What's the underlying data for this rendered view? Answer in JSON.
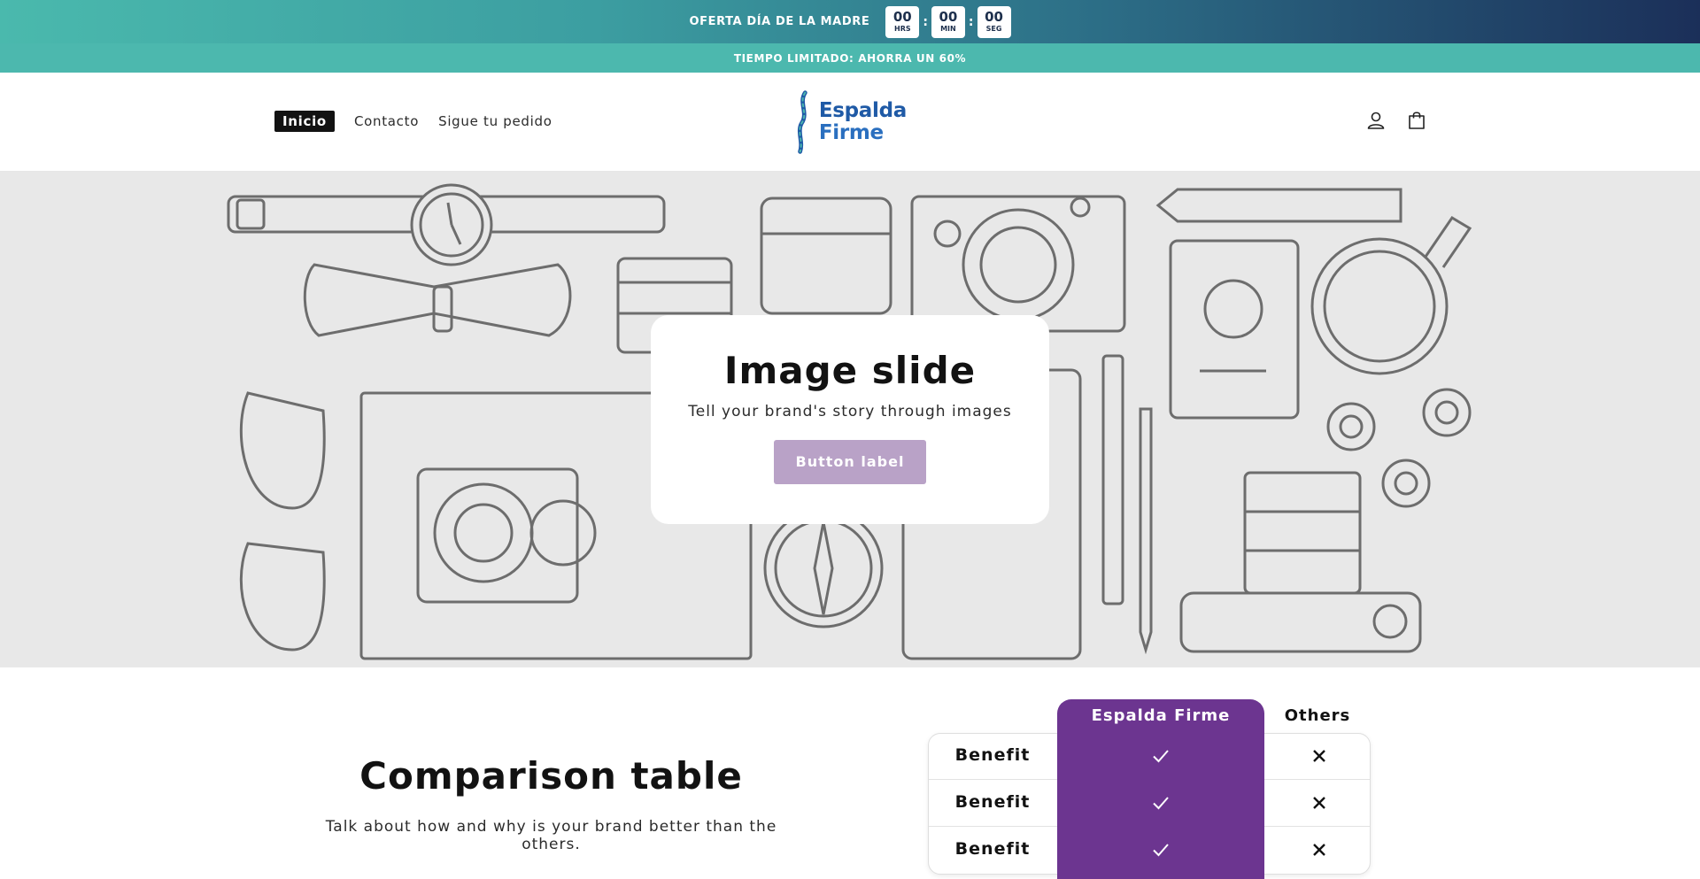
{
  "countdown": {
    "offer_text": "OFERTA DÍA DE LA MADRE",
    "hours": "00",
    "hours_label": "HRS",
    "minutes": "00",
    "minutes_label": "MIN",
    "seconds": "00",
    "seconds_label": "SEG",
    "separator": ":"
  },
  "announcement": {
    "text": "TIEMPO LIMITADO: AHORRA UN 60%"
  },
  "nav": {
    "items": [
      {
        "label": "Inicio",
        "active": true
      },
      {
        "label": "Contacto"
      },
      {
        "label": "Sigue tu pedido"
      }
    ]
  },
  "logo": {
    "line1": "Espalda",
    "line2": "Firme"
  },
  "header_icons": [
    "account-icon",
    "cart-icon"
  ],
  "slide": {
    "title": "Image slide",
    "subtitle": "Tell your brand's story through images",
    "button_label": "Button label"
  },
  "comparison": {
    "title": "Comparison table",
    "description": "Talk about how and why is your brand better than the others.",
    "brand_column": "Espalda Firme",
    "others_column": "Others",
    "rows": [
      {
        "label": "Benefit",
        "brand": "check-icon",
        "others": "cross-icon"
      },
      {
        "label": "Benefit",
        "brand": "check-icon",
        "others": "cross-icon"
      },
      {
        "label": "Benefit",
        "brand": "check-icon",
        "others": "cross-icon"
      }
    ]
  },
  "colors": {
    "banner_start": "#4ab9ad",
    "banner_end": "#1b2f59",
    "announce_bg": "#4cb8ae",
    "brand_purple": "#6c3590",
    "slide_button": "#b9a2c7",
    "logo_blue": "#1f5aa6"
  }
}
